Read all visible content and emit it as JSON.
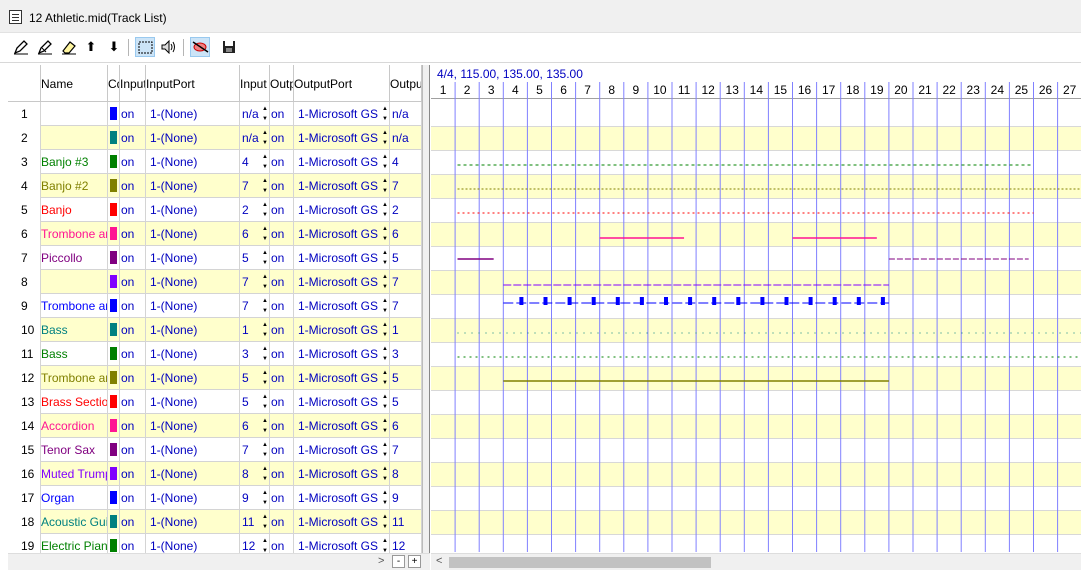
{
  "window": {
    "title": "12 Athletic.mid(Track List)"
  },
  "toolbar": {
    "icons": [
      "edit-pencil-icon",
      "edit-pencil-alt-icon",
      "eraser-icon",
      "arrow-up-icon",
      "arrow-down-icon",
      "select-rect-icon",
      "speaker-icon",
      "record-mute-icon",
      "save-disk-icon"
    ],
    "arrow_up": "⬆",
    "arrow_down": "⬇",
    "speaker": "🔊",
    "save": "💾"
  },
  "columns": [
    "Name",
    "Cd",
    "Input",
    "InputPort",
    "Input",
    "Outp",
    "OutputPort",
    "Output"
  ],
  "row_count": 19,
  "tracks": [
    {
      "num": "1",
      "name": "",
      "color": "#0000ff",
      "input": "on",
      "inport": "1-(None)",
      "inch": "n/a",
      "out": "on",
      "outport": "1-Microsoft GS",
      "outch": "n/a"
    },
    {
      "num": "2",
      "name": "",
      "color": "#008080",
      "input": "on",
      "inport": "1-(None)",
      "inch": "n/a",
      "out": "on",
      "outport": "1-Microsoft GS",
      "outch": "n/a"
    },
    {
      "num": "3",
      "name": "Banjo #3",
      "color": "#008000",
      "input": "on",
      "inport": "1-(None)",
      "inch": "4",
      "out": "on",
      "outport": "1-Microsoft GS",
      "outch": "4"
    },
    {
      "num": "4",
      "name": "Banjo #2",
      "color": "#808000",
      "input": "on",
      "inport": "1-(None)",
      "inch": "7",
      "out": "on",
      "outport": "1-Microsoft GS",
      "outch": "7"
    },
    {
      "num": "5",
      "name": "Banjo",
      "color": "#ff0000",
      "input": "on",
      "inport": "1-(None)",
      "inch": "2",
      "out": "on",
      "outport": "1-Microsoft GS",
      "outch": "2"
    },
    {
      "num": "6",
      "name": "Trombone ar",
      "color": "#ff1493",
      "input": "on",
      "inport": "1-(None)",
      "inch": "6",
      "out": "on",
      "outport": "1-Microsoft GS",
      "outch": "6"
    },
    {
      "num": "7",
      "name": "Piccollo",
      "color": "#800080",
      "input": "on",
      "inport": "1-(None)",
      "inch": "5",
      "out": "on",
      "outport": "1-Microsoft GS",
      "outch": "5"
    },
    {
      "num": "8",
      "name": "",
      "color": "#8000ff",
      "input": "on",
      "inport": "1-(None)",
      "inch": "7",
      "out": "on",
      "outport": "1-Microsoft GS",
      "outch": "7"
    },
    {
      "num": "9",
      "name": "Trombone ar",
      "color": "#0000ff",
      "input": "on",
      "inport": "1-(None)",
      "inch": "7",
      "out": "on",
      "outport": "1-Microsoft GS",
      "outch": "7"
    },
    {
      "num": "10",
      "name": "Bass",
      "color": "#008080",
      "input": "on",
      "inport": "1-(None)",
      "inch": "1",
      "out": "on",
      "outport": "1-Microsoft GS",
      "outch": "1"
    },
    {
      "num": "11",
      "name": "Bass",
      "color": "#008000",
      "input": "on",
      "inport": "1-(None)",
      "inch": "3",
      "out": "on",
      "outport": "1-Microsoft GS",
      "outch": "3"
    },
    {
      "num": "12",
      "name": "Trombone ar",
      "color": "#808000",
      "input": "on",
      "inport": "1-(None)",
      "inch": "5",
      "out": "on",
      "outport": "1-Microsoft GS",
      "outch": "5"
    },
    {
      "num": "13",
      "name": "Brass Sectior",
      "color": "#ff0000",
      "input": "on",
      "inport": "1-(None)",
      "inch": "5",
      "out": "on",
      "outport": "1-Microsoft GS",
      "outch": "5"
    },
    {
      "num": "14",
      "name": "Accordion",
      "color": "#ff1493",
      "input": "on",
      "inport": "1-(None)",
      "inch": "6",
      "out": "on",
      "outport": "1-Microsoft GS",
      "outch": "6"
    },
    {
      "num": "15",
      "name": "Tenor Sax",
      "color": "#800080",
      "input": "on",
      "inport": "1-(None)",
      "inch": "7",
      "out": "on",
      "outport": "1-Microsoft GS",
      "outch": "7"
    },
    {
      "num": "16",
      "name": "Muted Trump",
      "color": "#8000ff",
      "input": "on",
      "inport": "1-(None)",
      "inch": "8",
      "out": "on",
      "outport": "1-Microsoft GS",
      "outch": "8"
    },
    {
      "num": "17",
      "name": "Organ",
      "color": "#0000ff",
      "input": "on",
      "inport": "1-(None)",
      "inch": "9",
      "out": "on",
      "outport": "1-Microsoft GS",
      "outch": "9"
    },
    {
      "num": "18",
      "name": "Acoustic Guit",
      "color": "#008080",
      "input": "on",
      "inport": "1-(None)",
      "inch": "11",
      "out": "on",
      "outport": "1-Microsoft GS",
      "outch": "11"
    },
    {
      "num": "19",
      "name": "Electric Pianc",
      "color": "#008000",
      "input": "on",
      "inport": "1-(None)",
      "inch": "12",
      "out": "on",
      "outport": "1-Microsoft GS",
      "outch": "12"
    }
  ],
  "timeline": {
    "header": "4/4, 115.00, 135.00, 135.00",
    "measures": [
      "1",
      "2",
      "3",
      "4",
      "5",
      "6",
      "7",
      "8",
      "9",
      "10",
      "11",
      "12",
      "13",
      "14",
      "15",
      "16",
      "17",
      "18",
      "19",
      "20",
      "21",
      "22",
      "23",
      "24",
      "25",
      "26",
      "27"
    ]
  },
  "scrollbar": {
    "left_arrow": "<",
    "right_arrow": ">",
    "minus": "-",
    "plus": "+"
  },
  "colors": {
    "accent": "#0000c0",
    "row_alt": "#ffffcc",
    "grid_line": "#8080ff"
  }
}
